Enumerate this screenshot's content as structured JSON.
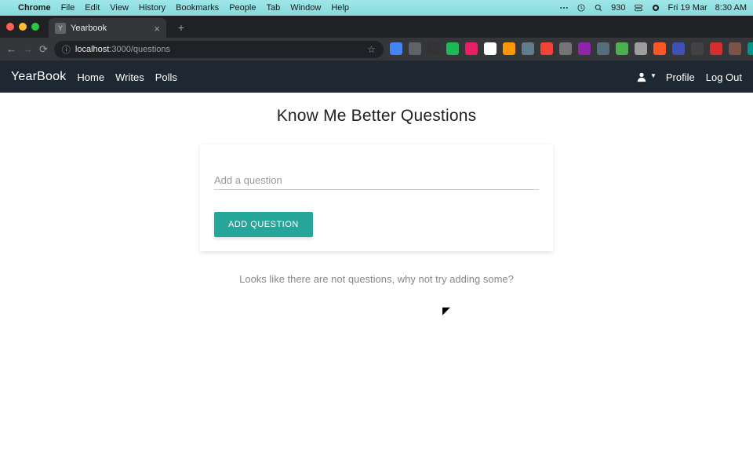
{
  "menubar": {
    "appname": "Chrome",
    "items": [
      "File",
      "Edit",
      "View",
      "History",
      "Bookmarks",
      "People",
      "Tab",
      "Window",
      "Help"
    ],
    "battery": "930",
    "date": "Fri 19 Mar",
    "time": "8:30 AM"
  },
  "browser": {
    "tab": {
      "title": "Yearbook"
    },
    "url": {
      "host": "localhost",
      "port_path": ":3000/questions"
    }
  },
  "appnav": {
    "brand": "YearBook",
    "links": [
      "Home",
      "Writes",
      "Polls"
    ],
    "profile": "Profile",
    "logout": "Log Out"
  },
  "page": {
    "title": "Know Me Better Questions",
    "input_placeholder": "Add a question",
    "add_button": "ADD QUESTION",
    "empty_message": "Looks like there are not questions, why not try adding some?"
  },
  "ext_colors": [
    "#4285f4",
    "#5f6368",
    "#333",
    "#1db954",
    "#e91e63",
    "#fff",
    "#ff9800",
    "#607d8b",
    "#f44336",
    "#757575",
    "#8e24aa",
    "#546e7a",
    "#4caf50",
    "#9e9e9e",
    "#ff5722",
    "#3f51b5",
    "#424242",
    "#d32f2f",
    "#795548",
    "#009688"
  ]
}
